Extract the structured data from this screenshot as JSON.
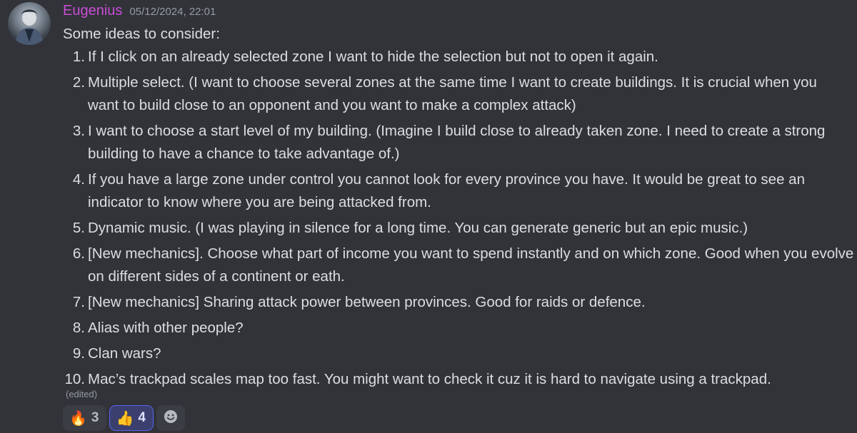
{
  "message": {
    "author": "Eugenius",
    "timestamp": "05/12/2024, 22:01",
    "intro": "Some ideas to consider:",
    "items": [
      {
        "number": "1.",
        "lines": [
          "If I click on an already selected zone I want to hide the selection but not to open it again."
        ]
      },
      {
        "number": "2.",
        "lines": [
          "Multiple select. (I want to choose several zones at the same time I want to create buildings. It is crucial when you",
          "want to build close to an opponent and you want to make a complex attack)"
        ]
      },
      {
        "number": "3.",
        "lines": [
          "I want to choose a start level of my building. (Imagine I build close to already taken zone. I need to create a strong",
          "building to have a chance to take advantage of.)"
        ]
      },
      {
        "number": "4.",
        "lines": [
          "If you have a large zone under control you cannot look for every province you have. It would be great to see an",
          "indicator to know where you are being attacked from."
        ]
      },
      {
        "number": "5.",
        "lines": [
          "Dynamic music. (I was playing in silence for a long time. You can generate generic but an epic music.)"
        ]
      },
      {
        "number": "6.",
        "lines": [
          "[New mechanics]. Choose what part of income you want to spend instantly and on which zone. Good when you evolve",
          "on different sides of a continent or eath."
        ]
      },
      {
        "number": "7.",
        "lines": [
          "[New mechanics] Sharing attack power between provinces. Good for raids or defence."
        ]
      },
      {
        "number": "8.",
        "lines": [
          "Alias with other people?"
        ]
      },
      {
        "number": "9.",
        "lines": [
          "Clan wars?"
        ]
      },
      {
        "number": "10.",
        "lines": [
          "Mac’s trackpad scales map too fast. You might want to check it cuz it is hard to navigate using a trackpad."
        ]
      }
    ],
    "edited_label": "(edited)"
  },
  "reactions": [
    {
      "emoji": "🔥",
      "icon": "fire-icon",
      "count": "3",
      "selected": false
    },
    {
      "emoji": "👍",
      "icon": "thumbs-up-icon",
      "count": "4",
      "selected": true
    }
  ],
  "add_reaction_icon": "smiley-face-icon",
  "colors": {
    "background": "#313338",
    "username": "#c94dd6",
    "text": "#dbdee1",
    "muted": "#949ba4",
    "reaction_bg": "#3b3d44",
    "reaction_selected_bg": "#3a3f6e",
    "reaction_selected_border": "#5865f2"
  }
}
